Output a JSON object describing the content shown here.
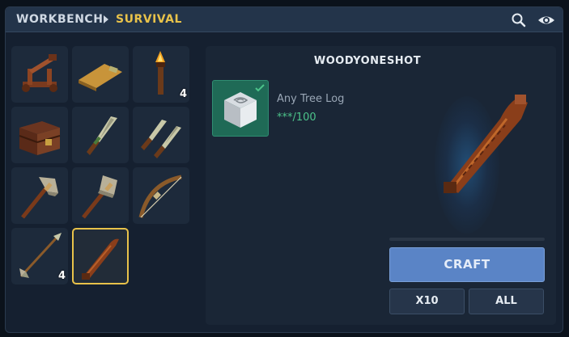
{
  "header": {
    "breadcrumb_root": "WORKBENCH",
    "breadcrumb_current": "SURVIVAL",
    "icons": [
      "search-icon",
      "eye-icon"
    ]
  },
  "recipes": [
    {
      "name": "catapult",
      "count": ""
    },
    {
      "name": "bedroll",
      "count": ""
    },
    {
      "name": "torch",
      "count": "4"
    },
    {
      "name": "storage-chest",
      "count": ""
    },
    {
      "name": "stone-knife",
      "count": ""
    },
    {
      "name": "dual-knives",
      "count": ""
    },
    {
      "name": "stone-axe",
      "count": ""
    },
    {
      "name": "stone-hammer",
      "count": ""
    },
    {
      "name": "bow",
      "count": ""
    },
    {
      "name": "arrow",
      "count": "4"
    },
    {
      "name": "woodyoneshot",
      "count": "",
      "selected": true
    }
  ],
  "detail": {
    "item_name": "WOODYONESHOT",
    "ingredient": {
      "name": "Any Tree Log",
      "quantity": "***/100",
      "satisfied": true
    },
    "craft_label": "CRAFT",
    "x10_label": "X10",
    "all_label": "ALL"
  },
  "colors": {
    "accent": "#e8c24a",
    "craft_button": "#5a84c6",
    "ingredient_ok": "#4cc38a",
    "ingredient_bg": "#1f6a56"
  }
}
